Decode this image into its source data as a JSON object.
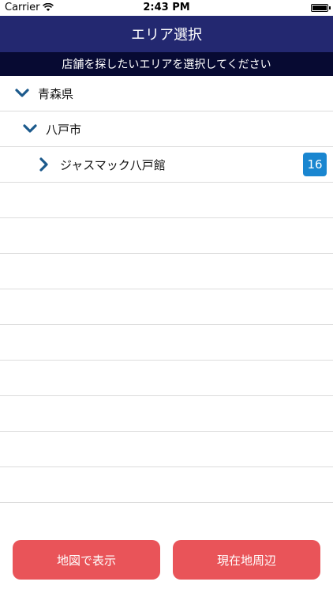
{
  "status_bar": {
    "carrier": "Carrier",
    "time": "2:43 PM"
  },
  "nav": {
    "title": "エリア選択"
  },
  "sub_header": {
    "text": "店舗を探したいエリアを選択してください"
  },
  "tree": {
    "prefecture": "青森県",
    "city": "八戸市",
    "store": "ジャスマック八戸館",
    "store_count": "16"
  },
  "buttons": {
    "map": "地図で表示",
    "nearby": "現在地周辺"
  },
  "colors": {
    "nav_bg": "#232870",
    "sub_header_bg": "#070a32",
    "chevron": "#1c5a8c",
    "badge": "#1a86d0",
    "button": "#e95459"
  }
}
